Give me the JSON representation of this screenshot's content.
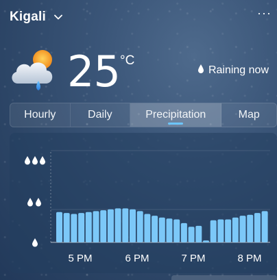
{
  "header": {
    "city": "Kigali",
    "more_label": "···"
  },
  "current": {
    "temperature": "25",
    "unit": "°C",
    "condition_icon": "partly-cloudy-rain-icon",
    "status": "Raining now"
  },
  "tabs": [
    {
      "label": "Hourly",
      "active": false
    },
    {
      "label": "Daily",
      "active": false
    },
    {
      "label": "Precipitation",
      "active": true
    },
    {
      "label": "Map",
      "active": false
    }
  ],
  "colors": {
    "bar": "#7cc8f8",
    "accent": "#6cc6ff"
  },
  "chart_data": {
    "type": "bar",
    "y_levels": [
      "light",
      "moderate",
      "heavy"
    ],
    "x_tick_labels": [
      "5 PM",
      "6 PM",
      "7 PM",
      "8 PM"
    ],
    "values": [
      0.33,
      0.32,
      0.31,
      0.32,
      0.33,
      0.34,
      0.35,
      0.36,
      0.37,
      0.37,
      0.36,
      0.34,
      0.31,
      0.29,
      0.27,
      0.26,
      0.25,
      0.21,
      0.17,
      0.18,
      0.02,
      0.24,
      0.25,
      0.25,
      0.27,
      0.29,
      0.3,
      0.32,
      0.34
    ],
    "grid": true
  }
}
